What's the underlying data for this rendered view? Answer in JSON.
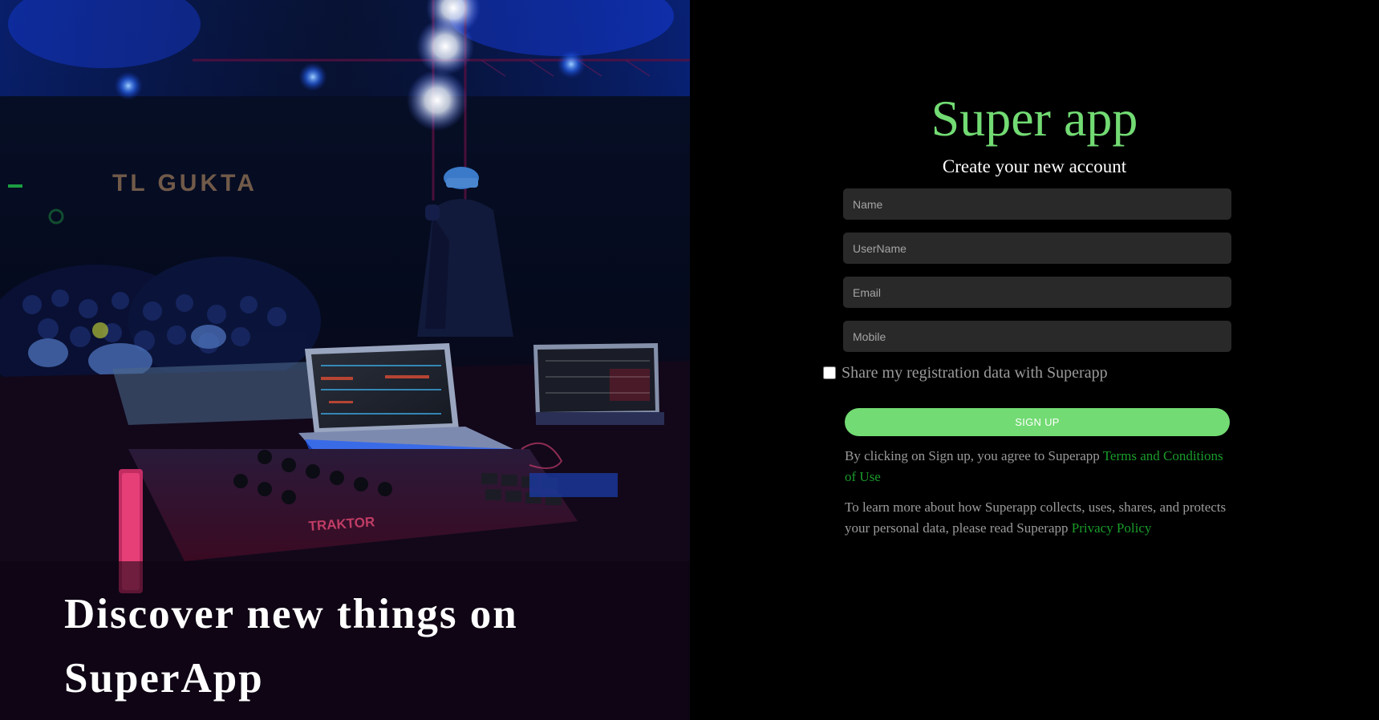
{
  "hero": {
    "headline": "Discover new things on SuperApp",
    "venue_sign": "TL GUKTA",
    "controller_brand": "TRAKTOR"
  },
  "form": {
    "brand": "Super app",
    "subtitle": "Create your new account",
    "fields": {
      "name_placeholder": "Name",
      "username_placeholder": "UserName",
      "email_placeholder": "Email",
      "mobile_placeholder": "Mobile"
    },
    "consent_label": "Share my registration data with Superapp",
    "consent_checked": false,
    "signup_label": "SIGN UP",
    "terms": {
      "text": "By clicking on Sign up, you agree to Superapp ",
      "link": "Terms and Conditions of Use"
    },
    "privacy": {
      "text": "To learn more about how Superapp collects, uses, shares, and protects your personal data, please read Superapp ",
      "link": "Privacy Policy"
    }
  },
  "colors": {
    "accent": "#72db73",
    "link": "#1a9b2b",
    "field_bg": "#292929",
    "muted_text": "#9b9b9b",
    "background": "#000000"
  }
}
